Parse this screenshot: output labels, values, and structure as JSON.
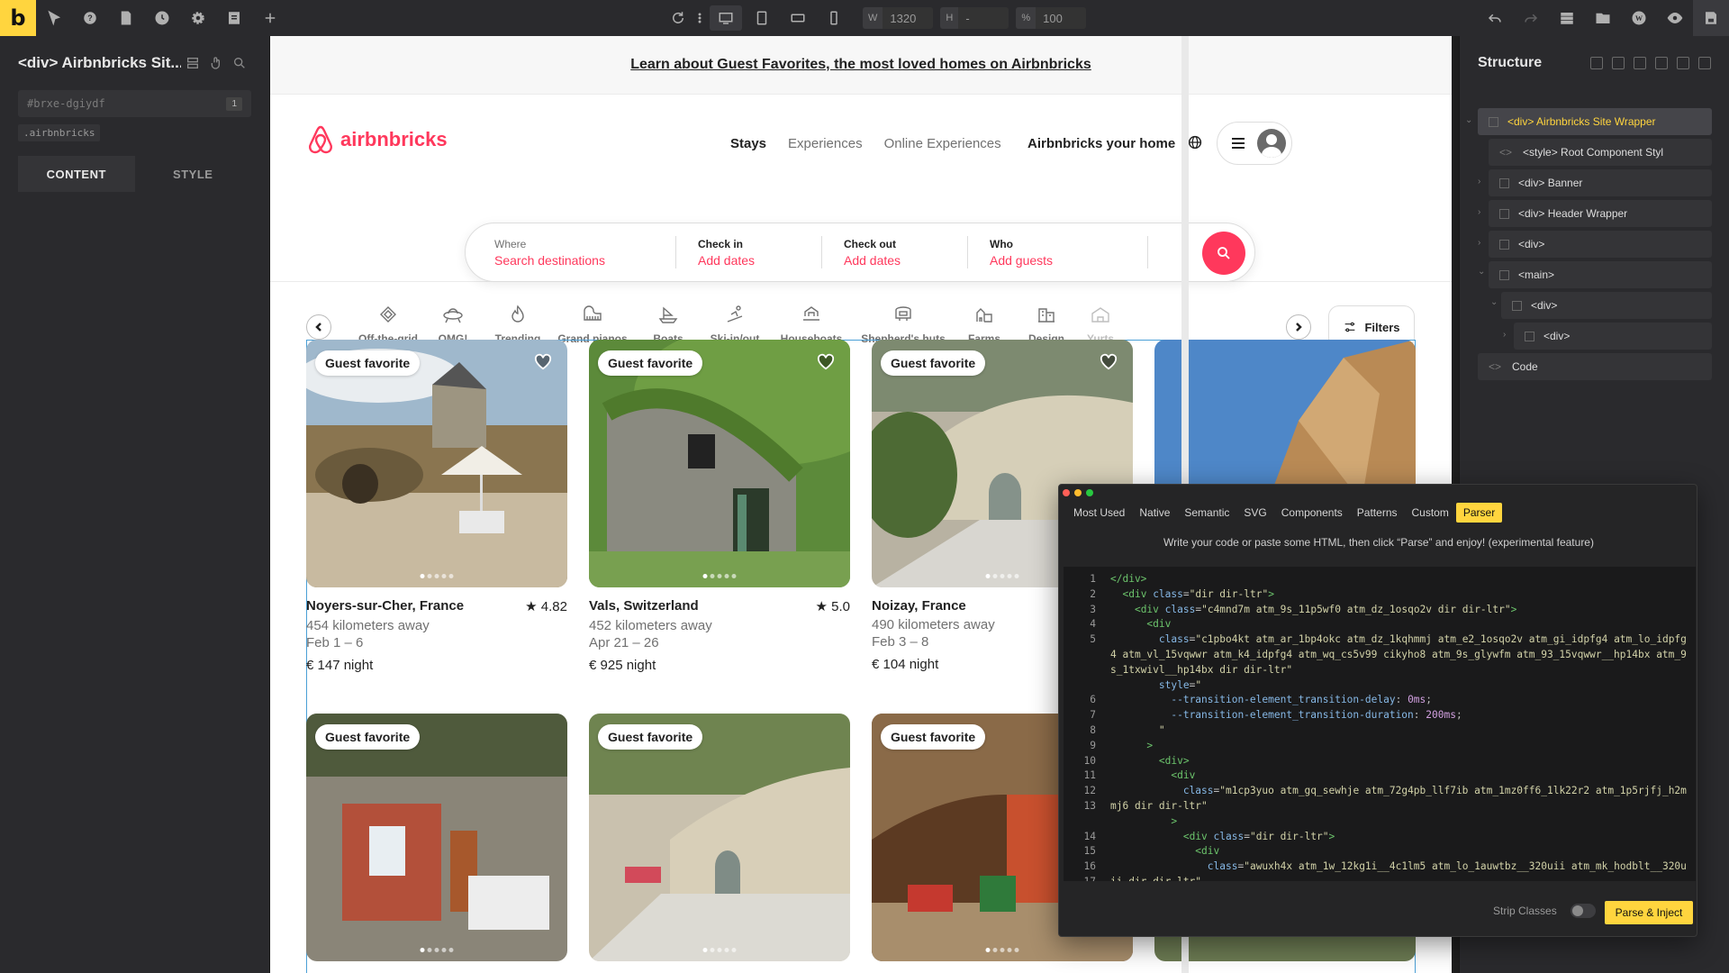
{
  "toolbar": {
    "logo": "b",
    "width_label": "W",
    "width_value": "1320",
    "height_label": "H",
    "height_value": "-",
    "zoom_label": "%",
    "zoom_value": "100"
  },
  "left_panel": {
    "title": "<div> Airbnbricks Sit...",
    "element_id": "#brxe-dgiydf",
    "id_count": "1",
    "class_name": ".airbnbricks",
    "tabs": [
      "CONTENT",
      "STYLE"
    ]
  },
  "site": {
    "banner": "Learn about Guest Favorites, the most loved homes on Airbnbricks",
    "brand": "airbnbricks",
    "nav": [
      "Stays",
      "Experiences",
      "Online Experiences"
    ],
    "host_link": "Airbnbricks your home",
    "search": [
      {
        "label": "Where",
        "value": "Search destinations"
      },
      {
        "label": "Check in",
        "value": "Add dates"
      },
      {
        "label": "Check out",
        "value": "Add dates"
      },
      {
        "label": "Who",
        "value": "Add guests"
      }
    ],
    "categories": [
      "Off-the-grid",
      "OMG!",
      "Trending",
      "Grand pianos",
      "Boats",
      "Ski-in/out",
      "Houseboats",
      "Shepherd's huts",
      "Farms",
      "Design",
      "Yurts"
    ],
    "filters_label": "Filters",
    "listings": [
      {
        "badge": "Guest favorite",
        "place": "Noyers-sur-Cher, France",
        "rating": "4.82",
        "distance": "454 kilometers away",
        "dates": "Feb 1 – 6",
        "price": "€ 147 night"
      },
      {
        "badge": "Guest favorite",
        "place": "Vals, Switzerland",
        "rating": "5.0",
        "distance": "452 kilometers away",
        "dates": "Apr 21 – 26",
        "price": "€ 925 night"
      },
      {
        "badge": "Guest favorite",
        "place": "Noizay, France",
        "rating": "",
        "distance": "490 kilometers away",
        "dates": "Feb 3 – 8",
        "price": "€ 104 night"
      },
      {
        "badge": "",
        "place": "",
        "rating": "",
        "distance": "",
        "dates": "",
        "price": ""
      },
      {
        "badge": "Guest favorite"
      },
      {
        "badge": "Guest favorite"
      },
      {
        "badge": "Guest favorite"
      }
    ]
  },
  "structure": {
    "title": "Structure",
    "items": [
      "<div> Airbnbricks Site Wrapper",
      "<style> Root Component Styl",
      "<div> Banner",
      "<div> Header Wrapper",
      "<div>",
      "<main>",
      "<div>",
      "<div>",
      "Code"
    ]
  },
  "parser": {
    "tabs": [
      "Most Used",
      "Native",
      "Semantic",
      "SVG",
      "Components",
      "Patterns",
      "Custom",
      "Parser"
    ],
    "active_tab": "Parser",
    "description": "Write your code or paste some HTML, then click “Parse” and enjoy! (experimental feature)",
    "line_numbers": [
      "1",
      "2",
      "3",
      "4",
      "5",
      "",
      "",
      "",
      "6",
      "7",
      "8",
      "9",
      "10",
      "11",
      "12",
      "13",
      "",
      "14",
      "15",
      "16",
      "17"
    ],
    "strip_label": "Strip Classes",
    "button": "Parse & Inject"
  },
  "colors": {
    "accent": "#ff385c",
    "builder_yellow": "#ffd53e",
    "selection_outline": "#4a9fd6"
  }
}
